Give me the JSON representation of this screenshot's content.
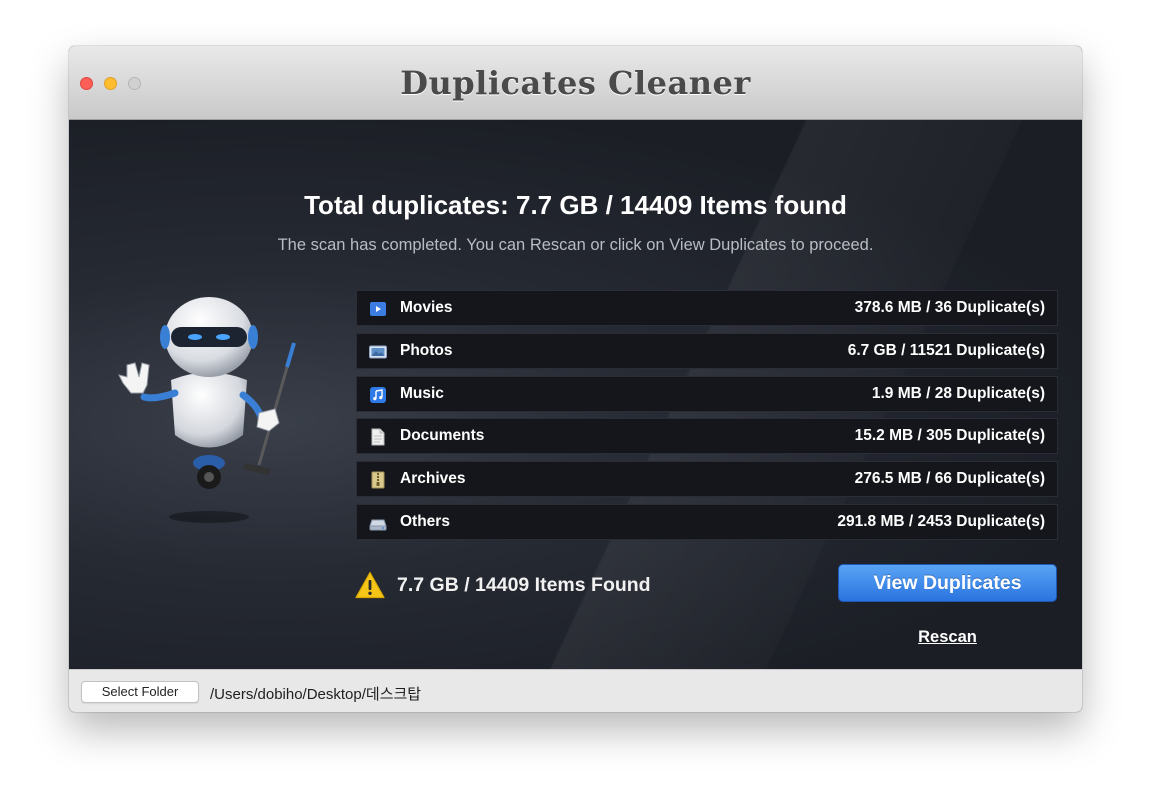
{
  "window": {
    "title": "Duplicates Cleaner"
  },
  "summary": {
    "headline": "Total duplicates: 7.7 GB / 14409 Items found",
    "subline": "The scan has completed.  You can Rescan or click on View Duplicates to proceed."
  },
  "categories": [
    {
      "label": "Movies",
      "value": "378.6 MB / 36 Duplicate(s)",
      "icon": "movie-icon"
    },
    {
      "label": "Photos",
      "value": "6.7 GB / 11521 Duplicate(s)",
      "icon": "photo-icon"
    },
    {
      "label": "Music",
      "value": "1.9 MB / 28 Duplicate(s)",
      "icon": "music-icon"
    },
    {
      "label": "Documents",
      "value": "15.2 MB / 305 Duplicate(s)",
      "icon": "document-icon"
    },
    {
      "label": "Archives",
      "value": "276.5 MB / 66 Duplicate(s)",
      "icon": "archive-icon"
    },
    {
      "label": "Others",
      "value": "291.8 MB / 2453 Duplicate(s)",
      "icon": "drive-icon"
    }
  ],
  "footer_status": {
    "found_text": "7.7 GB / 14409 Items Found",
    "icon": "warning-icon"
  },
  "actions": {
    "view_duplicates_label": "View Duplicates",
    "rescan_label": "Rescan"
  },
  "bottombar": {
    "select_folder_label": "Select Folder",
    "path": "/Users/dobiho/Desktop/데스크탑"
  },
  "colors": {
    "accent_blue": "#3b86ee",
    "background_dark": "#1c1f27",
    "warning_yellow": "#f5c518"
  }
}
